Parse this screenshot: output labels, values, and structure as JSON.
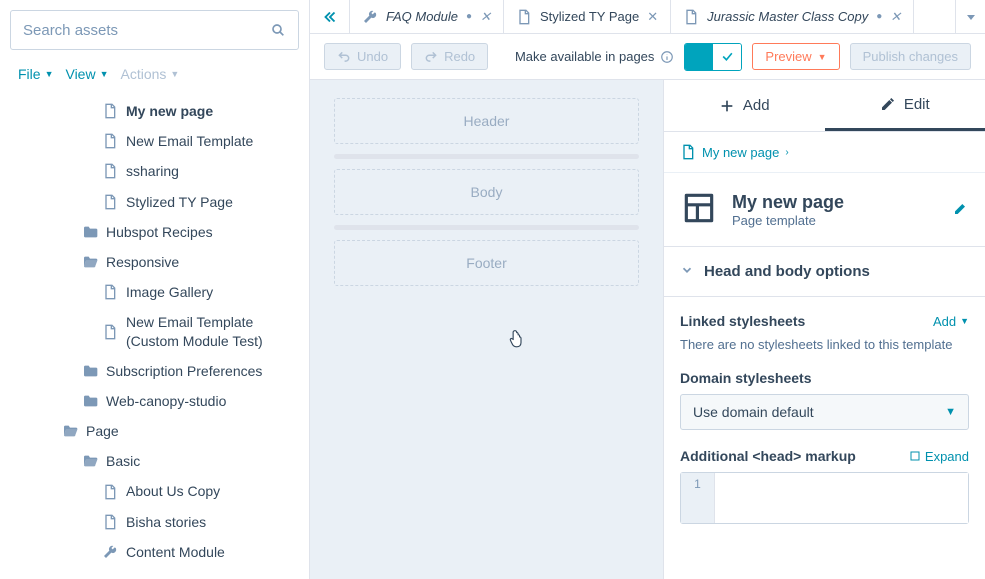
{
  "search": {
    "placeholder": "Search assets"
  },
  "menubar": {
    "file": "File",
    "view": "View",
    "actions": "Actions"
  },
  "tree": {
    "items": [
      {
        "type": "file",
        "label": "My new page",
        "depth": 3,
        "selected": true,
        "icon": "file"
      },
      {
        "type": "file",
        "label": "New Email Template",
        "depth": 3,
        "icon": "file"
      },
      {
        "type": "file",
        "label": "ssharing",
        "depth": 3,
        "icon": "file"
      },
      {
        "type": "file",
        "label": "Stylized TY Page",
        "depth": 3,
        "icon": "file"
      },
      {
        "type": "folder",
        "label": "Hubspot Recipes",
        "depth": 2,
        "icon": "folder"
      },
      {
        "type": "folder",
        "label": "Responsive",
        "depth": 2,
        "icon": "folder-open"
      },
      {
        "type": "file",
        "label": "Image Gallery",
        "depth": 3,
        "icon": "file"
      },
      {
        "type": "file",
        "label": "New Email Template (Custom Module Test)",
        "depth": 3,
        "icon": "file"
      },
      {
        "type": "folder",
        "label": "Subscription Preferences",
        "depth": 2,
        "icon": "folder"
      },
      {
        "type": "folder",
        "label": "Web-canopy-studio",
        "depth": 2,
        "icon": "folder"
      },
      {
        "type": "folder",
        "label": "Page",
        "depth": 1,
        "icon": "folder-open"
      },
      {
        "type": "folder",
        "label": "Basic",
        "depth": 2,
        "icon": "folder-open"
      },
      {
        "type": "file",
        "label": "About Us Copy",
        "depth": 3,
        "icon": "file"
      },
      {
        "type": "file",
        "label": "Bisha stories",
        "depth": 3,
        "icon": "file"
      },
      {
        "type": "file",
        "label": "Content Module",
        "depth": 3,
        "icon": "wrench"
      }
    ]
  },
  "tabs": [
    {
      "label": "FAQ Module",
      "icon": "wrench",
      "dirty": true,
      "active": true
    },
    {
      "label": "Stylized TY Page",
      "icon": "file",
      "dirty": false
    },
    {
      "label": "Jurassic Master Class Copy",
      "icon": "file",
      "dirty": true,
      "italic": true
    }
  ],
  "toolbar": {
    "undo": "Undo",
    "redo": "Redo",
    "available": "Make available in pages",
    "preview": "Preview",
    "publish": "Publish changes"
  },
  "canvas": {
    "header": "Header",
    "body": "Body",
    "footer": "Footer"
  },
  "panel": {
    "add": "Add",
    "edit": "Edit",
    "crumb": "My new page",
    "title": "My new page",
    "subtitle": "Page template",
    "section": "Head and body options",
    "linked": {
      "label": "Linked stylesheets",
      "action": "Add",
      "help": "There are no stylesheets linked to this template"
    },
    "domain": {
      "label": "Domain stylesheets",
      "value": "Use domain default"
    },
    "head": {
      "label": "Additional <head> markup",
      "action": "Expand",
      "line": "1"
    }
  }
}
